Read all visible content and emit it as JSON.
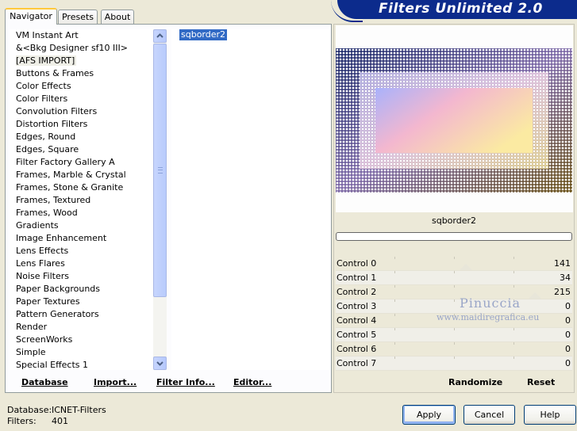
{
  "tabs": [
    {
      "label": "Navigator",
      "active": true
    },
    {
      "label": "Presets",
      "active": false
    },
    {
      "label": "About",
      "active": false
    }
  ],
  "banner": {
    "title": "Filters Unlimited 2.0"
  },
  "categories": [
    "VM Instant Art",
    "&<Bkg Designer sf10 III>",
    "[AFS IMPORT]",
    "Buttons & Frames",
    "Color Effects",
    "Color Filters",
    "Convolution Filters",
    "Distortion Filters",
    "Edges, Round",
    "Edges, Square",
    "Filter Factory Gallery A",
    "Frames, Marble & Crystal",
    "Frames, Stone & Granite",
    "Frames, Textured",
    "Frames, Wood",
    "Gradients",
    "Image Enhancement",
    "Lens Effects",
    "Lens Flares",
    "Noise Filters",
    "Paper Backgrounds",
    "Paper Textures",
    "Pattern Generators",
    "Render",
    "ScreenWorks",
    "Simple",
    "Special Effects 1"
  ],
  "selected_category_index": 2,
  "filters": [
    "sqborder2"
  ],
  "left_buttons": {
    "database": "Database",
    "import": "Import...",
    "filter_info": "Filter Info...",
    "editor": "Editor..."
  },
  "preview": {
    "filter_name": "sqborder2"
  },
  "controls": [
    {
      "label": "Control 0",
      "value": "141"
    },
    {
      "label": "Control 1",
      "value": "34"
    },
    {
      "label": "Control 2",
      "value": "215"
    },
    {
      "label": "Control 3",
      "value": "0"
    },
    {
      "label": "Control 4",
      "value": "0"
    },
    {
      "label": "Control 5",
      "value": "0"
    },
    {
      "label": "Control 6",
      "value": "0"
    },
    {
      "label": "Control 7",
      "value": "0"
    }
  ],
  "watermark": {
    "name": "Pinuccia",
    "site": "www.maidiregrafica.eu"
  },
  "right_buttons": {
    "randomize": "Randomize",
    "reset": "Reset"
  },
  "status": {
    "database_label": "Database:",
    "database_value": "ICNET-Filters",
    "filters_label": "Filters:",
    "filters_value": "401"
  },
  "dialog_buttons": {
    "apply": "Apply",
    "cancel": "Cancel",
    "help": "Help"
  },
  "colors": {
    "banner": "#0c2b8c",
    "selection": "#316ac5",
    "scrollbar": "#c7d5fd",
    "background": "#ece9d8"
  },
  "icons": {
    "scroll_up": "chevron-up-icon",
    "scroll_down": "chevron-down-icon"
  }
}
